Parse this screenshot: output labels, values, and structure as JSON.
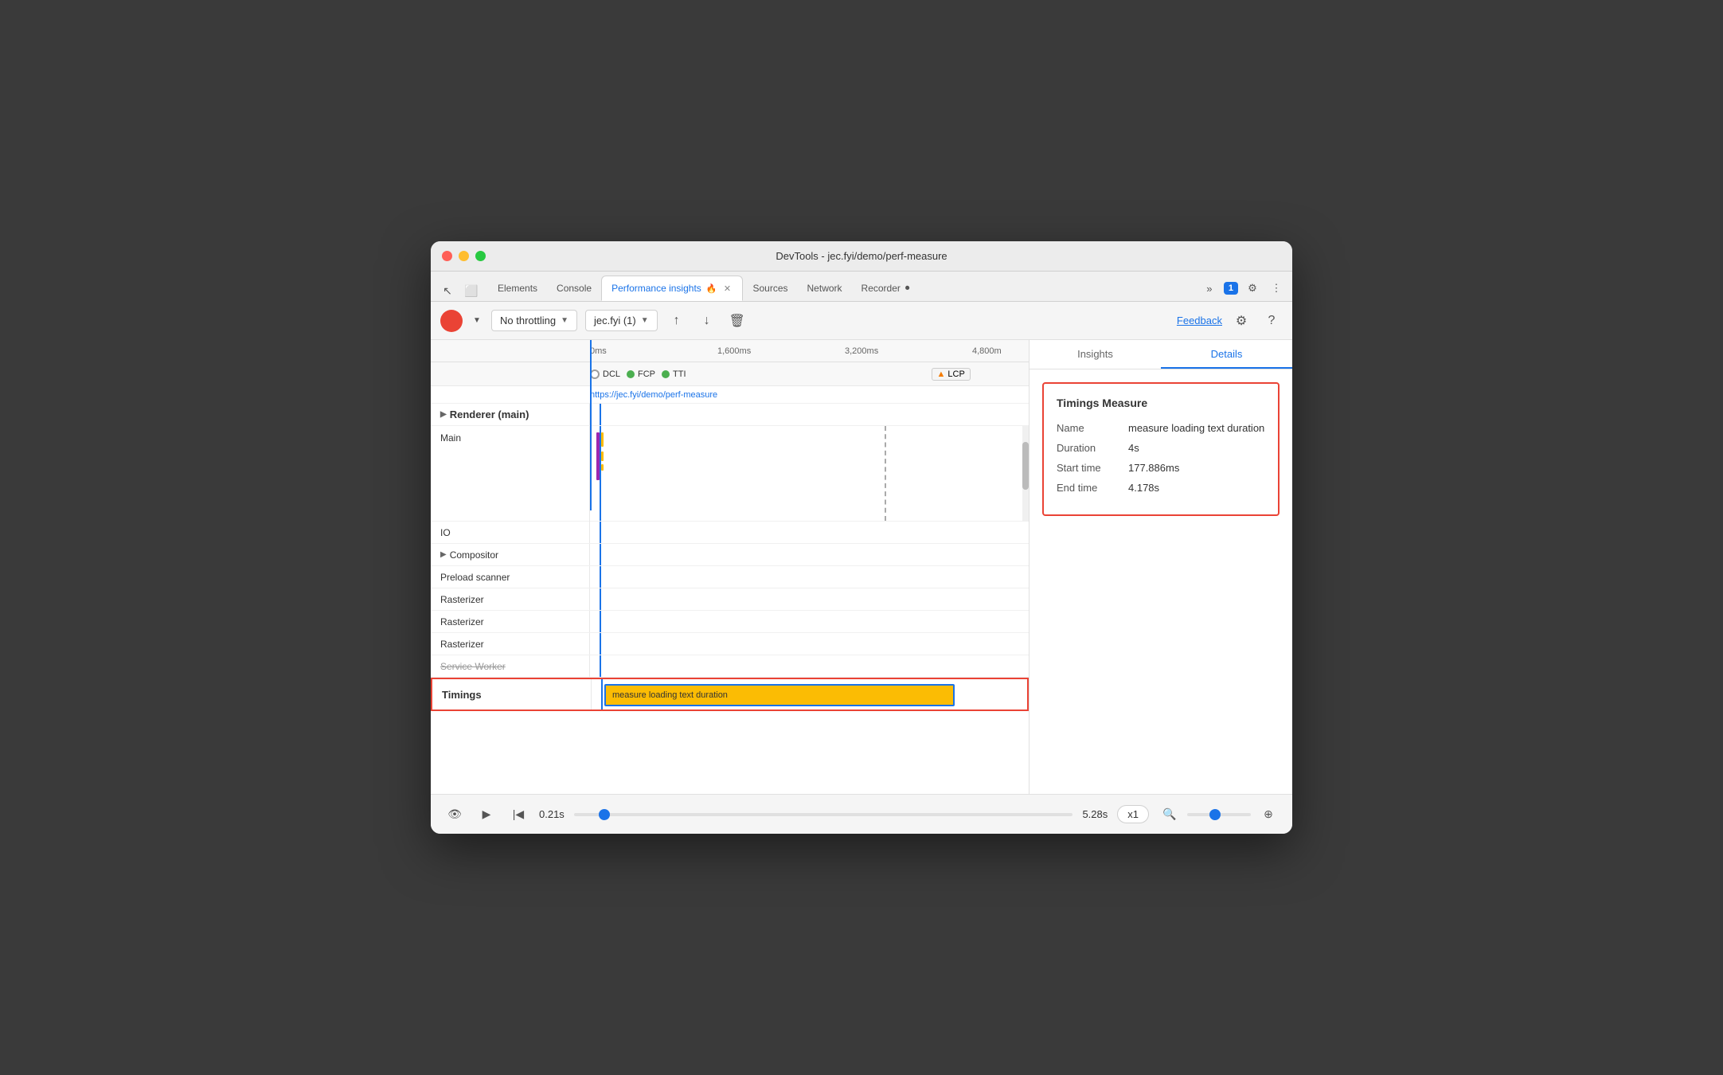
{
  "window": {
    "title": "DevTools - jec.fyi/demo/perf-measure"
  },
  "tabs": {
    "items": [
      {
        "label": "Elements",
        "active": false
      },
      {
        "label": "Console",
        "active": false
      },
      {
        "label": "Performance insights",
        "active": true,
        "has_icon": true
      },
      {
        "label": "Sources",
        "active": false
      },
      {
        "label": "Network",
        "active": false
      },
      {
        "label": "Recorder",
        "active": false,
        "has_icon": true
      }
    ],
    "more_label": "»",
    "chat_badge": "1"
  },
  "toolbar": {
    "throttling_label": "No throttling",
    "site_label": "jec.fyi (1)",
    "feedback_label": "Feedback"
  },
  "timeline": {
    "ruler_marks": [
      "0ms",
      "1,600ms",
      "3,200ms",
      "4,800m"
    ],
    "url": "https://jec.fyi/demo/perf-measure",
    "flags": [
      {
        "type": "circle-outline",
        "color": "#9e9e9e",
        "label": "DCL"
      },
      {
        "type": "dot",
        "color": "#4caf50",
        "label": "FCP"
      },
      {
        "type": "dot",
        "color": "#4caf50",
        "label": "TTI"
      },
      {
        "type": "warning",
        "color": "#f57c00",
        "label": "LCP"
      }
    ],
    "tracks": [
      {
        "label": "Renderer (main)",
        "type": "expander",
        "expanded": true
      },
      {
        "label": "Main",
        "type": "main",
        "tall": true
      },
      {
        "label": "",
        "type": "spacer"
      },
      {
        "label": "IO",
        "type": "normal"
      },
      {
        "label": "Compositor",
        "type": "expander"
      },
      {
        "label": "Preload scanner",
        "type": "normal"
      },
      {
        "label": "Rasterizer",
        "type": "normal"
      },
      {
        "label": "Rasterizer",
        "type": "normal"
      },
      {
        "label": "Rasterizer",
        "type": "normal"
      },
      {
        "label": "Service Worker",
        "type": "strikethrough"
      }
    ],
    "timings": {
      "label": "Timings",
      "bar_label": "measure loading text duration",
      "bar_left_pct": "3",
      "bar_width_pct": "57"
    }
  },
  "right_panel": {
    "tabs": [
      "Insights",
      "Details"
    ],
    "active_tab": "Details",
    "details": {
      "title": "Timings Measure",
      "rows": [
        {
          "label": "Name",
          "value": "measure loading text duration"
        },
        {
          "label": "Duration",
          "value": "4s"
        },
        {
          "label": "Start time",
          "value": "177.886ms"
        },
        {
          "label": "End time",
          "value": "4.178s"
        }
      ]
    }
  },
  "bottom_bar": {
    "time_start": "0.21s",
    "time_end": "5.28s",
    "speed": "x1"
  }
}
